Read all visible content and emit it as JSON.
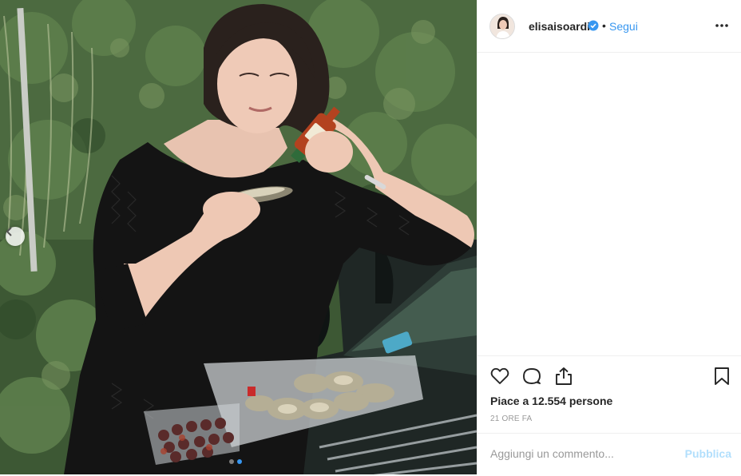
{
  "post": {
    "username": "elisaisoardi",
    "verified_icon": "verified-badge-icon",
    "bullet": "•",
    "follow_label": "Segui",
    "more_icon": "more-options-icon",
    "likes_text": "Piace a 12.554 persone",
    "time_text": "21 ORE FA",
    "comment_placeholder": "Aggiungi un commento...",
    "publish_label": "Pubblica"
  },
  "icons": {
    "like": "heart-icon",
    "comment": "comment-icon",
    "share": "share-icon",
    "save": "bookmark-icon",
    "prev": "chevron-left-icon"
  },
  "carousel": {
    "total": 2,
    "active": 2
  },
  "colors": {
    "link": "#3897f0",
    "text": "#262626",
    "muted": "#999999",
    "publish_disabled": "#b2dffc",
    "border": "#efefef"
  }
}
